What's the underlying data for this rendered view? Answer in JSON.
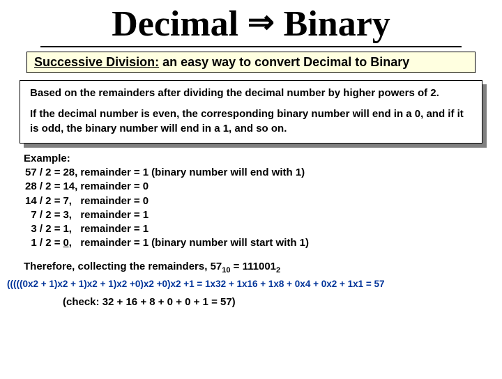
{
  "title": {
    "left": "Decimal",
    "right": "Binary"
  },
  "subtitle": {
    "label": "Successive Division:",
    "rest": " an easy way to convert Decimal to Binary"
  },
  "info": {
    "p1": "Based on the remainders after dividing the decimal number by higher powers of 2.",
    "p2": "If the decimal number is even, the corresponding binary number will end in a 0, and if it is odd, the binary number will end in a 1, and so on."
  },
  "example": {
    "heading": "Example:",
    "rows": [
      {
        "lhs": "57 / 2 =",
        "q": "28,",
        "rem": "remainder",
        "eq": "= 1",
        "note": "(binary number will end with 1)"
      },
      {
        "lhs": "28 / 2 =",
        "q": "14,",
        "rem": "remainder",
        "eq": "= 0",
        "note": ""
      },
      {
        "lhs": "14 / 2 =",
        "q": "7,",
        "rem": "remainder",
        "eq": "= 0",
        "note": ""
      },
      {
        "lhs": "7 / 2 =",
        "q": "3,",
        "rem": "remainder",
        "eq": "= 1",
        "note": ""
      },
      {
        "lhs": "3 / 2 =",
        "q": "1,",
        "rem": "remainder",
        "eq": "= 1",
        "note": ""
      },
      {
        "lhs": "1 / 2 =",
        "q": "0,",
        "rem": "remainder",
        "eq": "= 1",
        "note": "(binary number will start with 1)",
        "qUnderline": true
      }
    ]
  },
  "therefore": {
    "pre": "Therefore, collecting the remainders, 57",
    "sub1": "10",
    "mid": " = 111001",
    "sub2": "2"
  },
  "formula": "(((((0x2 + 1)x2 + 1)x2 + 1)x2 +0)x2 +0)x2 +1 = 1x32 + 1x16 + 1x8 + 0x4 + 0x2 + 1x1 = 57",
  "check": "(check: 32 + 16 + 8 + 0 + 0 + 1 = 57)"
}
